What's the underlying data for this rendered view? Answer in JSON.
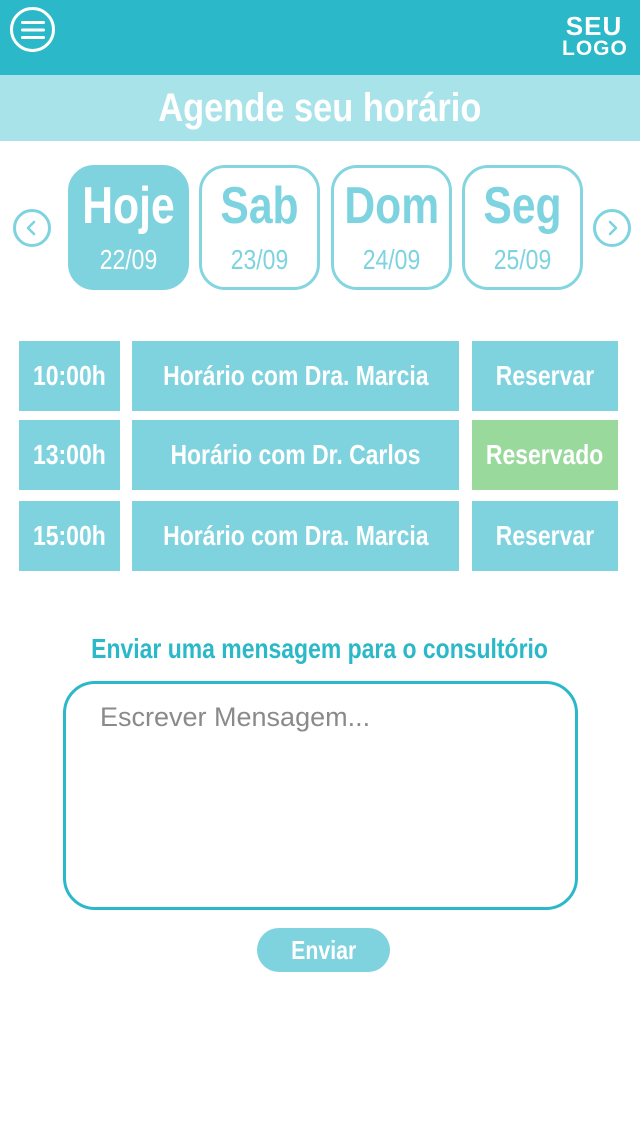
{
  "header": {
    "logo_line1": "SEU",
    "logo_line2": "LOGO",
    "menu_icon": "hamburger-icon"
  },
  "title": "Agende seu horário",
  "days": [
    {
      "name": "Hoje",
      "date": "22/09",
      "selected": true
    },
    {
      "name": "Sab",
      "date": "23/09",
      "selected": false
    },
    {
      "name": "Dom",
      "date": "24/09",
      "selected": false
    },
    {
      "name": "Seg",
      "date": "25/09",
      "selected": false
    }
  ],
  "nav": {
    "prev_icon": "chevron-left-icon",
    "next_icon": "chevron-right-icon"
  },
  "schedule": [
    {
      "time": "10:00h",
      "description": "Horário com Dra. Marcia",
      "action": "Reservar",
      "status": "available"
    },
    {
      "time": "13:00h",
      "description": "Horário com Dr. Carlos",
      "action": "Reservado",
      "status": "booked"
    },
    {
      "time": "15:00h",
      "description": "Horário com Dra. Marcia",
      "action": "Reservar",
      "status": "available"
    }
  ],
  "message": {
    "label": "Enviar uma mensagem para o consultório",
    "placeholder": "Escrever Mensagem...",
    "send_label": "Enviar"
  },
  "colors": {
    "primary": "#2bb8c8",
    "light": "#a9e3ea",
    "accent": "#7fd3de",
    "booked": "#9ad99c"
  }
}
